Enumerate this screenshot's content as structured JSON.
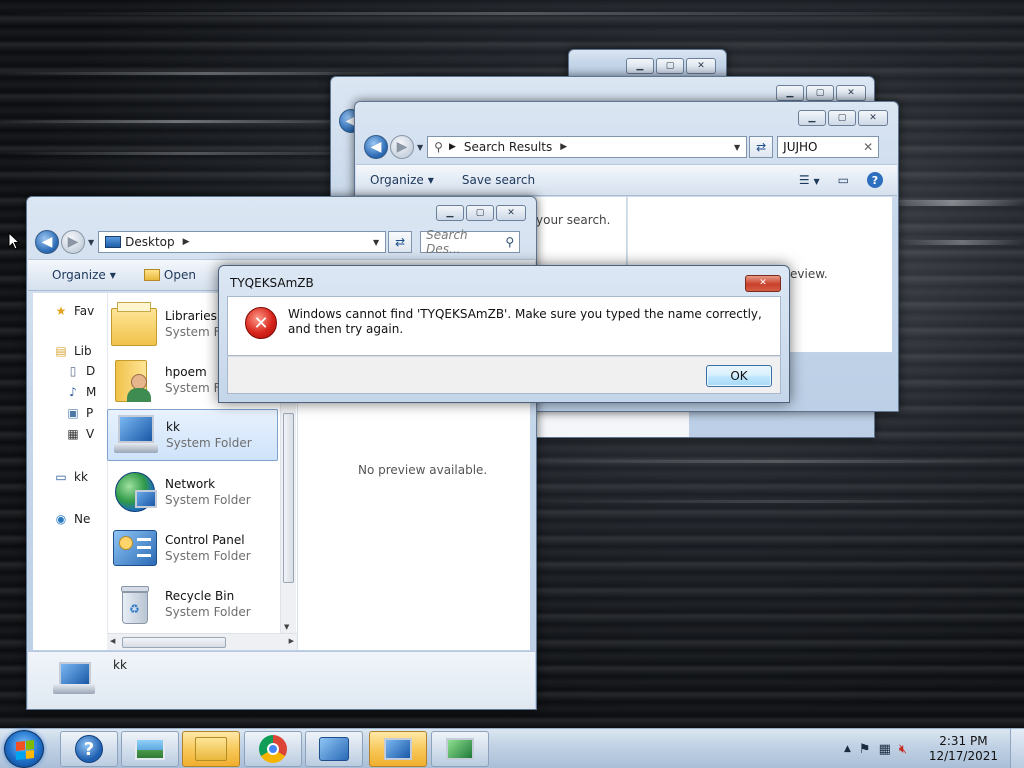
{
  "back_window_1": {},
  "back_window_2": {},
  "search_window": {
    "address": "Search Results",
    "search_value": "JUJHO",
    "toolbar": {
      "organize": "Organize",
      "save_search": "Save search"
    },
    "partial_text_1": "your search.",
    "partial_text_2": "eview."
  },
  "explorer": {
    "address": "Desktop",
    "search_placeholder": "Search Des...",
    "toolbar": {
      "organize": "Organize",
      "open": "Open"
    },
    "nav_pane": [
      {
        "label": "Fav"
      },
      {
        "label": "Lib"
      },
      {
        "label": "D"
      },
      {
        "label": "M"
      },
      {
        "label": "P"
      },
      {
        "label": "V"
      },
      {
        "label": "kk"
      },
      {
        "label": "Ne"
      }
    ],
    "items": [
      {
        "name": "Libraries",
        "type": "System Folder"
      },
      {
        "name": "hpoem",
        "type": "System Folder"
      },
      {
        "name": "kk",
        "type": "System Folder"
      },
      {
        "name": "Network",
        "type": "System Folder"
      },
      {
        "name": "Control Panel",
        "type": "System Folder"
      },
      {
        "name": "Recycle Bin",
        "type": "System Folder"
      }
    ],
    "preview_text": "No preview available.",
    "details_name": "kk"
  },
  "dialog": {
    "title": "TYQEKSAmZB",
    "message": "Windows cannot find 'TYQEKSAmZB'. Make sure you typed the name correctly, and then try again.",
    "ok_label": "OK"
  },
  "taskbar": {
    "time": "2:31 PM",
    "date": "12/17/2021"
  }
}
